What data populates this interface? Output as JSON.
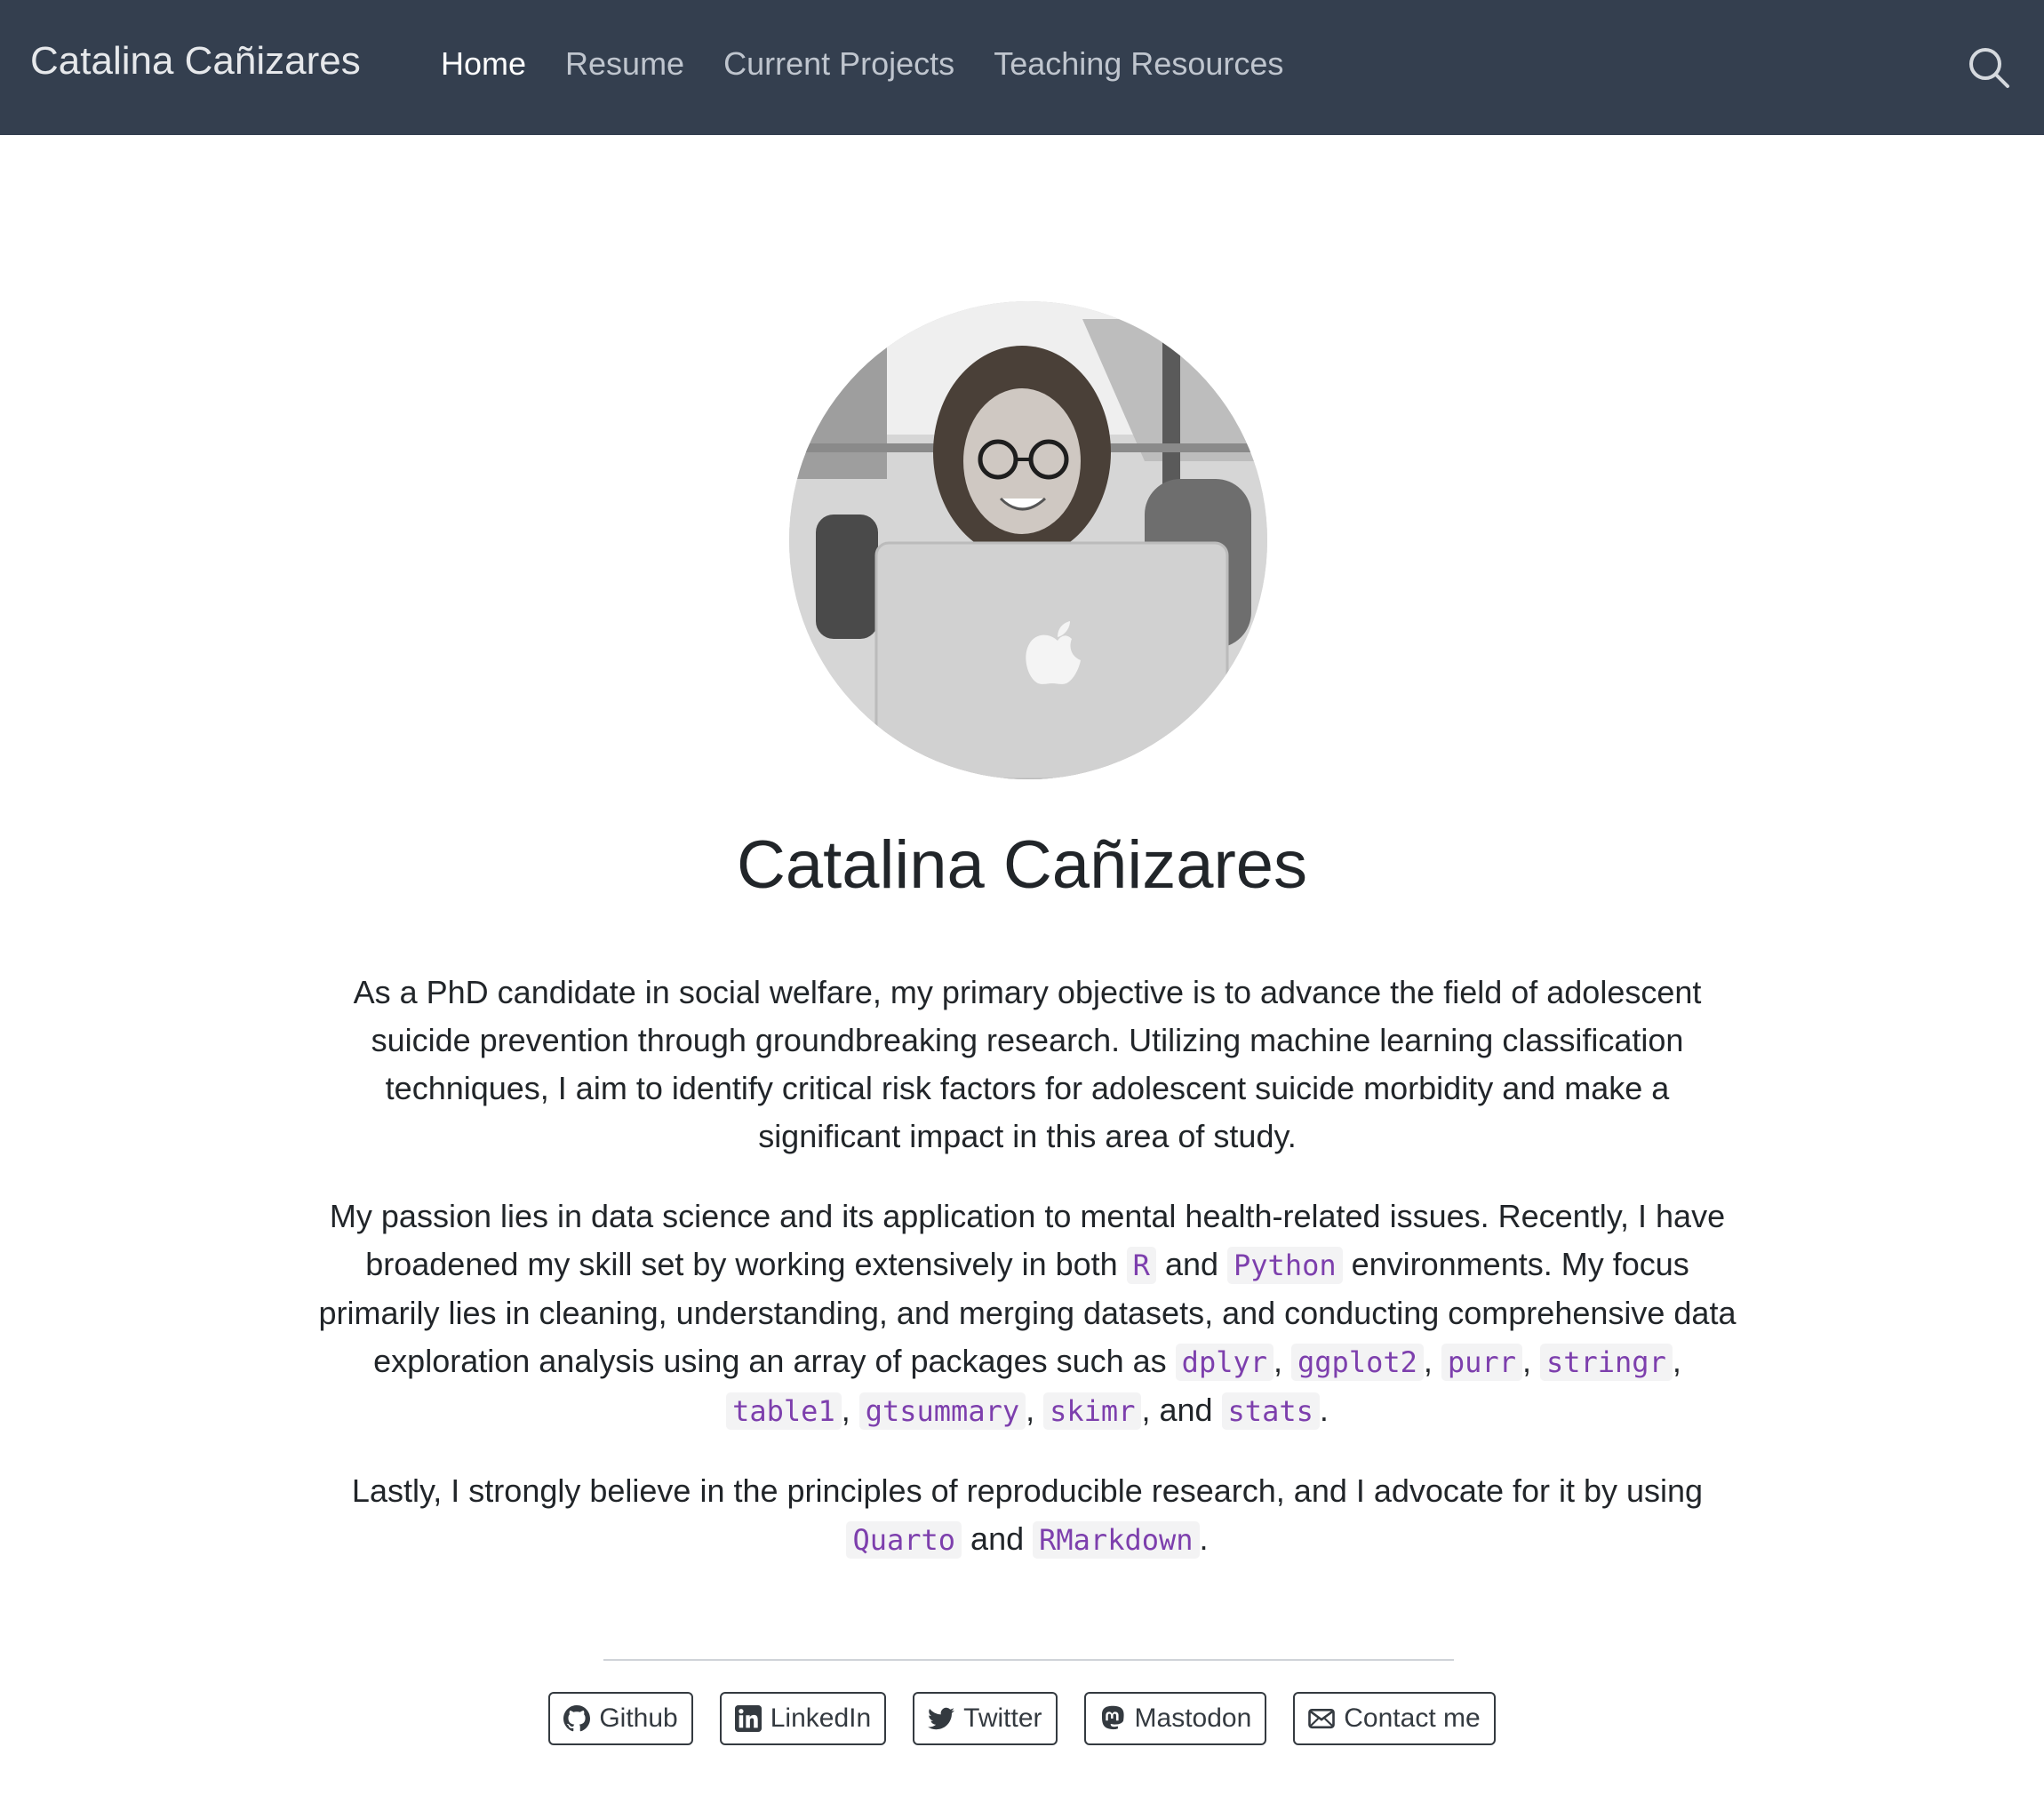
{
  "navbar": {
    "brand": "Catalina Cañizares",
    "links": [
      {
        "label": "Home",
        "active": true
      },
      {
        "label": "Resume",
        "active": false
      },
      {
        "label": "Current Projects",
        "active": false
      },
      {
        "label": "Teaching Resources",
        "active": false
      }
    ],
    "search_icon": "search-icon"
  },
  "profile": {
    "photo": "profile-photo",
    "name": "Catalina Cañizares"
  },
  "about": {
    "p1": "As a PhD candidate in social welfare, my primary objective is to advance the field of adolescent suicide prevention through groundbreaking research. Utilizing machine learning classification techniques, I aim to identify critical risk factors for adolescent suicide morbidity and make a significant impact in this area of study.",
    "p2": {
      "t1": "My passion lies in data science and its application to mental health-related issues. Recently, I have broadened my skill set by working extensively in both ",
      "c1": "R",
      "t2": " and ",
      "c2": "Python",
      "t3": " environments. My focus primarily lies in cleaning, understanding, and merging datasets, and conducting comprehensive data exploration analysis using an array of packages such as ",
      "c3": "dplyr",
      "s1": ", ",
      "c4": "ggplot2",
      "s2": ", ",
      "c5": "purr",
      "s3": ", ",
      "c6": "stringr",
      "s4": ", ",
      "c7": "table1",
      "s5": ", ",
      "c8": "gtsummary",
      "s6": ", ",
      "c9": "skimr",
      "t4": ", and ",
      "c10": "stats",
      "end": "."
    },
    "p3": {
      "t1": "Lastly, I strongly believe in the principles of reproducible research, and I advocate for it by using ",
      "c1": "Quarto",
      "t2": " and ",
      "c2": "RMarkdown",
      "end": "."
    }
  },
  "social_links": [
    {
      "label": "Github",
      "icon": "github-icon"
    },
    {
      "label": "LinkedIn",
      "icon": "linkedin-icon"
    },
    {
      "label": "Twitter",
      "icon": "twitter-icon"
    },
    {
      "label": "Mastodon",
      "icon": "mastodon-icon"
    },
    {
      "label": "Contact me",
      "icon": "envelope-icon"
    }
  ],
  "colors": {
    "navbar_bg": "#343f4f",
    "code_text": "#7d3fad",
    "code_bg": "#f3f3f4"
  }
}
